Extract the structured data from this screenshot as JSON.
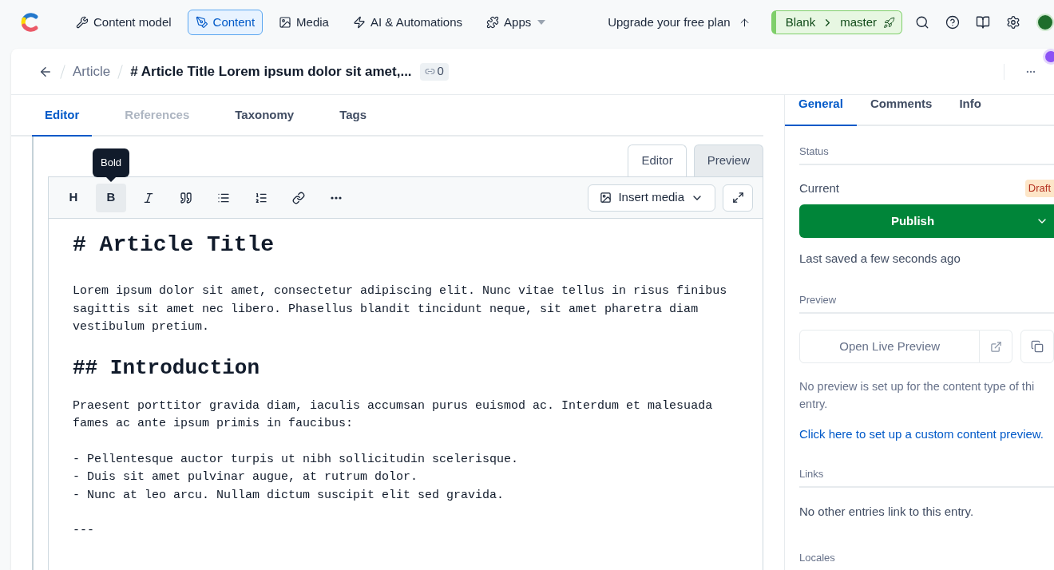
{
  "nav": {
    "items": [
      {
        "label": "Content model",
        "selected": false
      },
      {
        "label": "Content",
        "selected": true
      },
      {
        "label": "Media",
        "selected": false
      },
      {
        "label": "AI & Automations",
        "selected": false
      },
      {
        "label": "Apps",
        "selected": false,
        "dropdown": true
      }
    ],
    "upgrade": "Upgrade your free plan",
    "environment": {
      "space": "Blank",
      "branch": "master"
    }
  },
  "entry_header": {
    "breadcrumb": "Article",
    "title": "# Article Title Lorem ipsum dolor sit amet,...",
    "link_count": "0"
  },
  "editor_tabs": [
    {
      "label": "Editor",
      "selected": true,
      "disabled": false
    },
    {
      "label": "References",
      "selected": false,
      "disabled": true
    },
    {
      "label": "Taxonomy",
      "selected": false,
      "disabled": false
    },
    {
      "label": "Tags",
      "selected": false,
      "disabled": false
    }
  ],
  "mode_switch": [
    {
      "label": "Editor",
      "selected": false
    },
    {
      "label": "Preview",
      "selected": true
    }
  ],
  "toolbar": {
    "tools": [
      {
        "kind": "text",
        "label": "H",
        "selected": false
      },
      {
        "kind": "text",
        "label": "B",
        "selected": true,
        "tooltip": "Bold"
      },
      {
        "kind": "italic",
        "selected": false
      },
      {
        "kind": "quote",
        "selected": false
      },
      {
        "kind": "bullets",
        "selected": false
      },
      {
        "kind": "numbers",
        "selected": false
      },
      {
        "kind": "link",
        "selected": false
      },
      {
        "kind": "more",
        "selected": false
      }
    ],
    "insert_media": "Insert media"
  },
  "document": [
    {
      "kind": "h1",
      "lines": [
        "# Article Title"
      ]
    },
    {
      "kind": "p",
      "lines": [
        "Lorem ipsum dolor sit amet, consectetur adipiscing elit. Nunc vitae tellus in risus finibus",
        "sagittis sit amet nec libero. Phasellus blandit tincidunt neque, sit amet pharetra diam",
        "vestibulum pretium."
      ]
    },
    {
      "kind": "h2",
      "lines": [
        "## Introduction"
      ]
    },
    {
      "kind": "p",
      "lines": [
        "Praesent porttitor gravida diam, iaculis accumsan purus euismod ac. Interdum et malesuada",
        "fames ac ante ipsum primis in faucibus:"
      ]
    },
    {
      "kind": "p",
      "lines": [
        "- Pellentesque auctor turpis ut nibh sollicitudin scelerisque.",
        "- Duis sit amet pulvinar augue, at rutrum dolor.",
        "- Nunc at leo arcu. Nullam dictum suscipit elit sed gravida."
      ]
    },
    {
      "kind": "p",
      "lines": [
        "---"
      ]
    }
  ],
  "sidebar": {
    "tabs": [
      {
        "label": "General",
        "selected": true
      },
      {
        "label": "Comments",
        "selected": false
      },
      {
        "label": "Info",
        "selected": false
      }
    ],
    "status": {
      "heading": "Status",
      "label": "Current",
      "badge": "Draft",
      "publish": "Publish",
      "saved": "Last saved a few seconds ago"
    },
    "preview": {
      "heading": "Preview",
      "button": "Open Live Preview",
      "note": "No preview is set up for the content type of thi",
      "note_2": "entry.",
      "link": "Click here to set up a custom content preview."
    },
    "links": {
      "heading": "Links",
      "note": "No other entries link to this entry."
    },
    "locales": {
      "heading": "Locales"
    }
  }
}
